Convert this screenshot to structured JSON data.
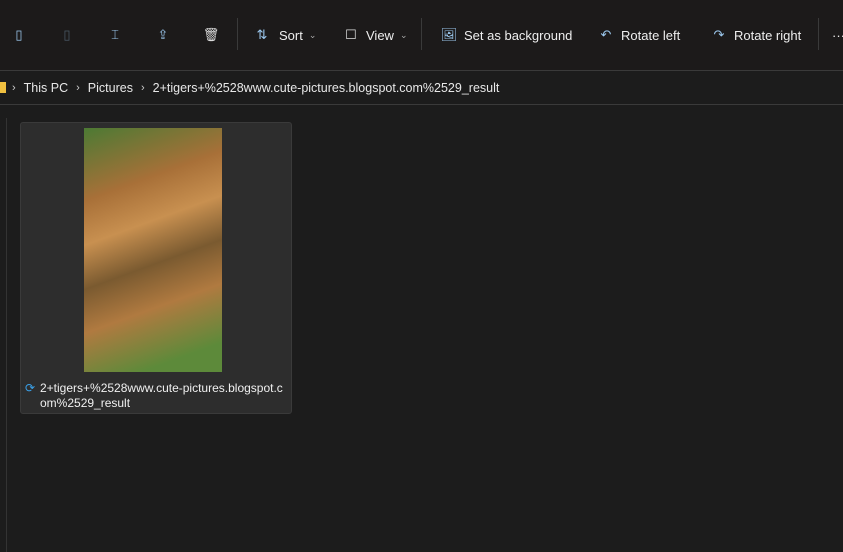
{
  "toolbar": {
    "sort": "Sort",
    "view": "View",
    "set_background": "Set as background",
    "rotate_left": "Rotate left",
    "rotate_right": "Rotate right",
    "more": "···"
  },
  "breadcrumb": [
    "This PC",
    "Pictures",
    "2+tigers+%2528www.cute-pictures.blogspot.com%2529_result"
  ],
  "file": {
    "name": "2+tigers+%2528www.cute-pictures.blogspot.com%2529_result"
  }
}
